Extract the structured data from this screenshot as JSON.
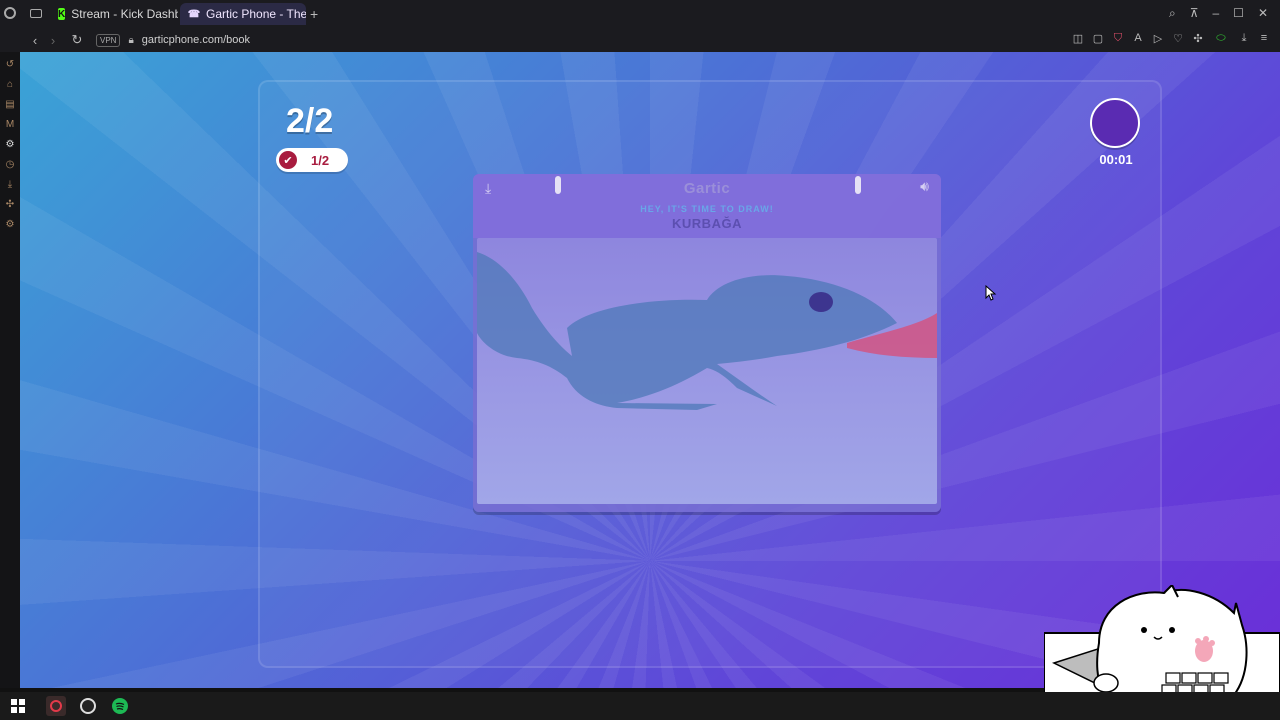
{
  "browser": {
    "tabs": [
      {
        "title": "Stream - Kick Dashboard",
        "icon": "kick-icon"
      },
      {
        "title": "Gartic Phone - The Teleph",
        "icon": "phone-icon"
      }
    ],
    "new_tab_label": "+",
    "vpn_label": "VPN",
    "url": "garticphone.com/book"
  },
  "game": {
    "round_counter": "2/2",
    "progress_badge": "1/2",
    "timer": "00:01",
    "card": {
      "logo": "Gartic",
      "prompt": "HEY, IT'S TIME TO DRAW!",
      "word": "KURBAĞA"
    }
  },
  "colors": {
    "accent_red": "#a81c3f",
    "timer_fill": "#5a2bb2",
    "gradient_start": "#3aa3d6",
    "gradient_end": "#6b2ed8"
  }
}
